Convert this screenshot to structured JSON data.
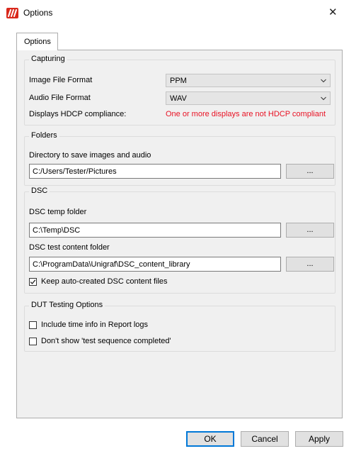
{
  "window": {
    "title": "Options",
    "close_glyph": "✕",
    "app_icon": "unigraf-logo-icon"
  },
  "tabs": [
    {
      "label": "Options",
      "active": true
    }
  ],
  "capturing": {
    "legend": "Capturing",
    "image_format_label": "Image File Format",
    "image_format_value": "PPM",
    "audio_format_label": "Audio File Format",
    "audio_format_value": "WAV",
    "hdcp_label": "Displays HDCP compliance:",
    "hdcp_value": "One or more displays are not HDCP compliant",
    "hdcp_color": "#e81123"
  },
  "folders": {
    "legend": "Folders",
    "dir_label": "Directory to save images and audio",
    "dir_value": "C:/Users/Tester/Pictures",
    "browse_label": "..."
  },
  "dsc": {
    "legend": "DSC",
    "temp_label": "DSC temp folder",
    "temp_value": "C:\\Temp\\DSC",
    "content_label": "DSC test content folder",
    "content_value": "C:\\ProgramData\\Unigraf\\DSC_content_library",
    "browse_label": "...",
    "keep_files_label": "Keep auto-created DSC content files",
    "keep_files_checked": true
  },
  "dut": {
    "legend": "DUT Testing Options",
    "time_info_label": "Include time info in Report logs",
    "time_info_checked": false,
    "dont_show_label": "Don't show 'test sequence completed'",
    "dont_show_checked": false
  },
  "footer": {
    "ok_label": "OK",
    "cancel_label": "Cancel",
    "apply_label": "Apply"
  },
  "colors": {
    "accent": "#0078d7",
    "brand": "#d9281b",
    "panel_bg": "#f0f0f0"
  }
}
